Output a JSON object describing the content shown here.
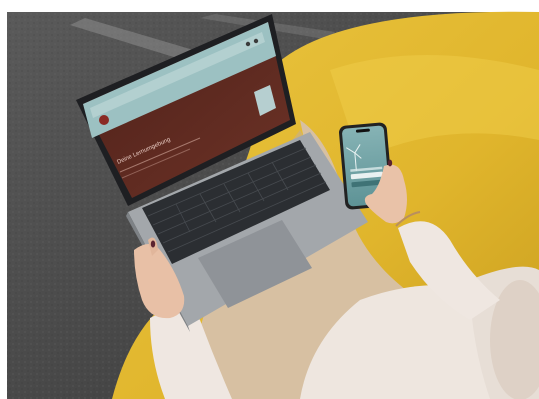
{
  "scene": {
    "laptop_screen": {
      "headline": "Deine Lern­umgebung",
      "body_text": ""
    },
    "phone_screen": {
      "time": "",
      "button_label": ""
    }
  },
  "colors": {
    "background": "#ffffff",
    "carpet": "#4a4a4a",
    "chair_yellow": "#e3b932",
    "laptop_body": "#9ea2a7",
    "laptop_keys": "#2c2f33",
    "screen_maroon": "#5b2a22",
    "screen_teal": "#8fb6b8",
    "phone_teal": "#6fa3a6",
    "sweater": "#efe7e1",
    "pants": "#d9c3a6",
    "skin": "#e9c2a8",
    "nail": "#5b2430"
  }
}
